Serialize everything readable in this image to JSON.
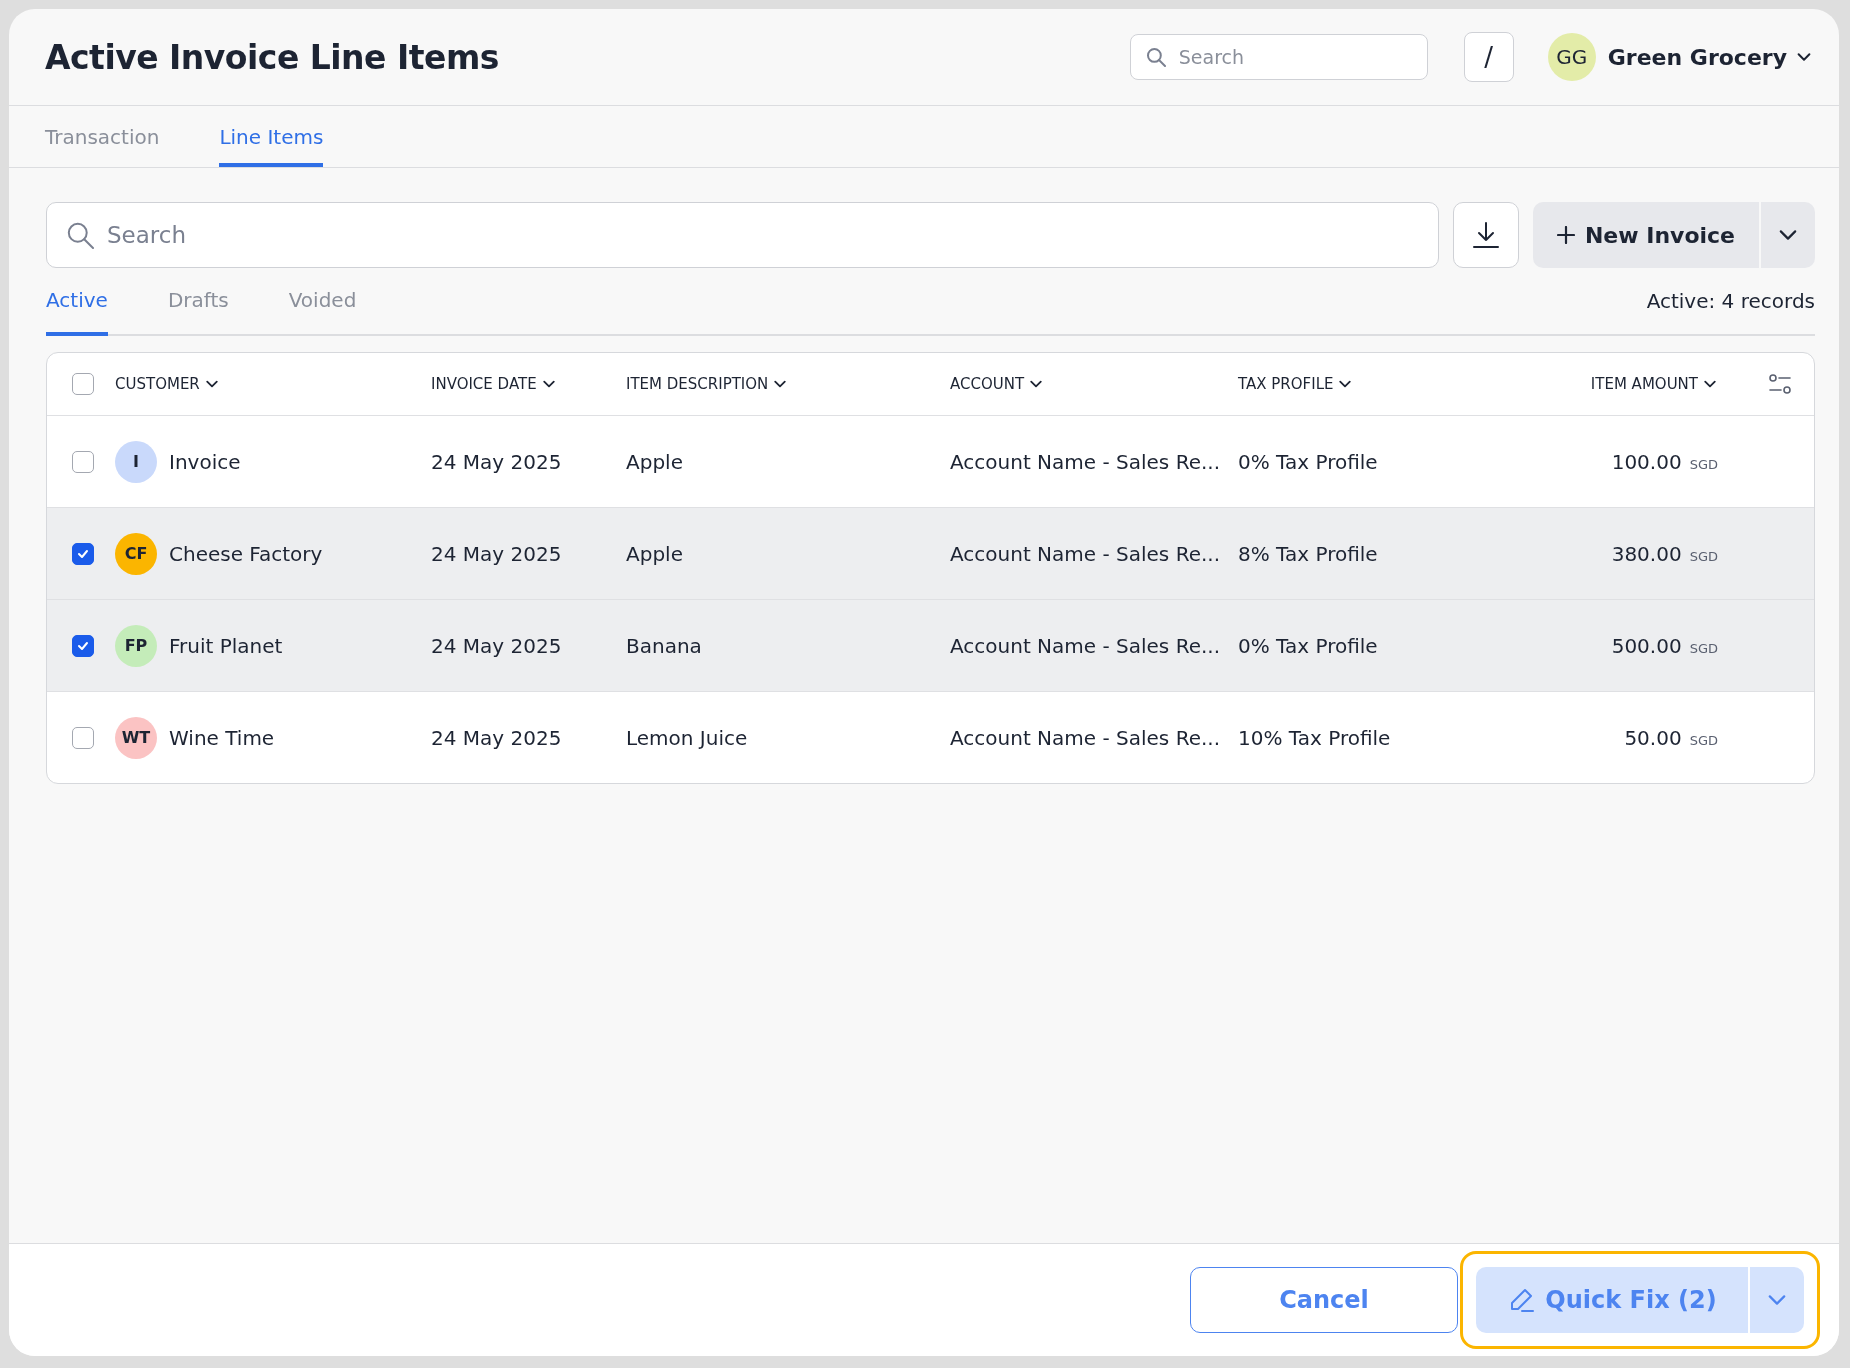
{
  "window": {
    "title": "Active Invoice Line Items"
  },
  "header": {
    "search": {
      "placeholder": "Search"
    },
    "shortcut_key": "/",
    "user": {
      "initials": "GG",
      "name": "Green Grocery",
      "color": "#e3eca8"
    }
  },
  "tabs": [
    {
      "label": "Transaction",
      "selected": false
    },
    {
      "label": "Line Items",
      "selected": true
    }
  ],
  "toolbar": {
    "search": {
      "placeholder": "Search"
    },
    "new_button": "New Invoice"
  },
  "status_tabs": [
    {
      "label": "Active",
      "selected": true
    },
    {
      "label": "Drafts",
      "selected": false
    },
    {
      "label": "Voided",
      "selected": false
    }
  ],
  "record_count": "Active: 4 records",
  "table": {
    "select_all": {
      "checked": false
    },
    "columns": [
      "CUSTOMER",
      "INVOICE DATE",
      "ITEM DESCRIPTION",
      "ACCOUNT",
      "TAX PROFILE",
      "ITEM AMOUNT"
    ],
    "rows": [
      {
        "selected": false,
        "initials": "I",
        "color": "#c9d9fb",
        "customer": "Invoice",
        "date": "24 May 2025",
        "description": "Apple",
        "account": "Account Name - Sales Re...",
        "tax_profile": "0% Tax Profile",
        "amount": "100.00",
        "currency": "SGD"
      },
      {
        "selected": true,
        "initials": "CF",
        "color": "#fbb500",
        "customer": "Cheese Factory",
        "date": "24 May 2025",
        "description": "Apple",
        "account": "Account Name - Sales Re...",
        "tax_profile": "8% Tax Profile",
        "amount": "380.00",
        "currency": "SGD"
      },
      {
        "selected": true,
        "initials": "FP",
        "color": "#c4ecb9",
        "customer": "Fruit Planet",
        "date": "24 May 2025",
        "description": "Banana",
        "account": "Account Name - Sales Re...",
        "tax_profile": "0% Tax Profile",
        "amount": "500.00",
        "currency": "SGD"
      },
      {
        "selected": false,
        "initials": "WT",
        "color": "#fbc3c3",
        "customer": "Wine Time",
        "date": "24 May 2025",
        "description": "Lemon Juice",
        "account": "Account Name - Sales Re...",
        "tax_profile": "10% Tax Profile",
        "amount": "50.00",
        "currency": "SGD"
      }
    ]
  },
  "footer": {
    "cancel": "Cancel",
    "quick_fix": {
      "label": "Quick Fix (2)",
      "highlighted": true
    }
  }
}
